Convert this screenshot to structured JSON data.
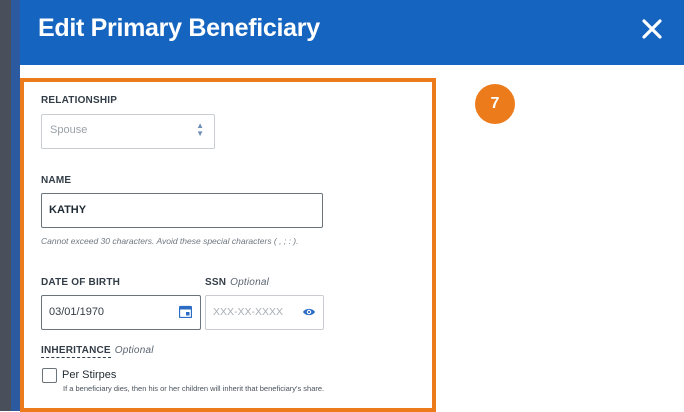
{
  "modal": {
    "title": "Edit Primary Beneficiary",
    "close_icon": "close-icon"
  },
  "step_badge": "7",
  "relationship": {
    "label": "RELATIONSHIP",
    "value": "Spouse",
    "icon": "select-arrows-icon"
  },
  "name": {
    "label": "NAME",
    "value": "KATHY",
    "hint": "Cannot exceed 30 characters. Avoid these special characters ( , ; : )."
  },
  "dob": {
    "label": "DATE OF BIRTH",
    "value": "03/01/1970",
    "icon": "calendar-icon"
  },
  "ssn": {
    "label": "SSN",
    "optional": "Optional",
    "placeholder": "XXX-XX-XXXX",
    "icon": "eye-icon"
  },
  "inheritance": {
    "label": "INHERITANCE",
    "optional": "Optional",
    "checkbox_label": "Per Stirpes",
    "checkbox_desc": "If a beneficiary dies, then his or her children will inherit that beneficiary's share.",
    "checked": false
  },
  "colors": {
    "header": "#1565c0",
    "highlight": "#ec7b1c"
  }
}
